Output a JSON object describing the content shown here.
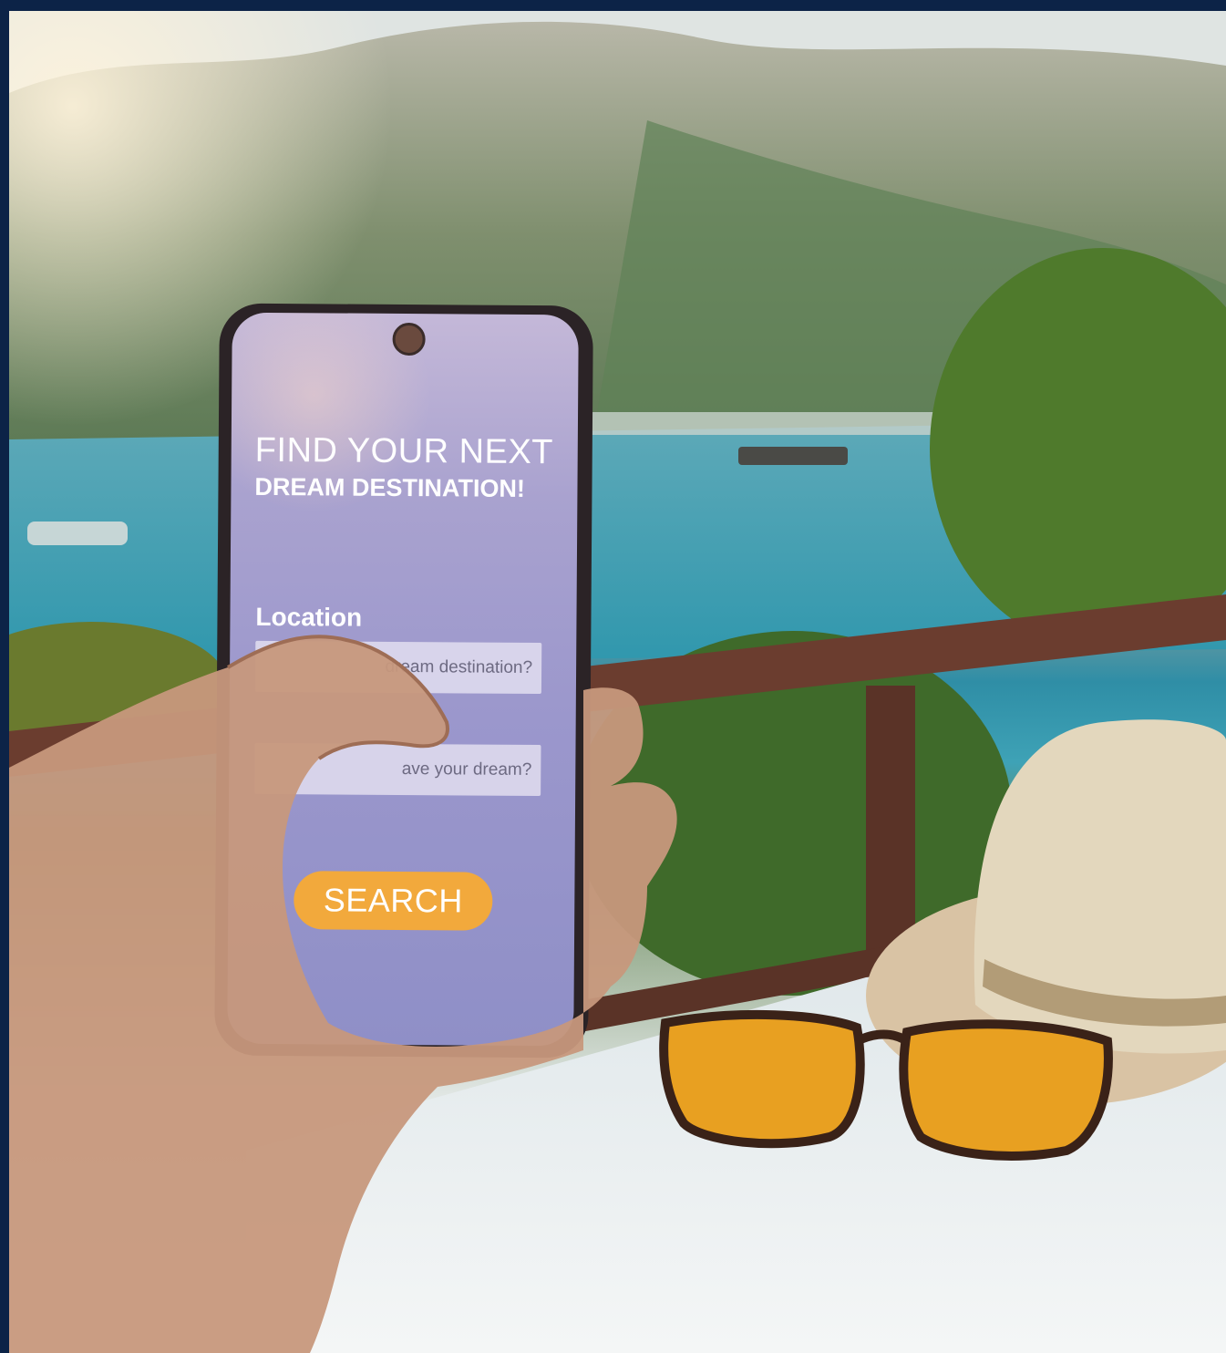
{
  "app": {
    "headline_line1": "FIND YOUR NEXT",
    "headline_line2": "DREAM DESTINATION!",
    "location_label": "Location",
    "location_placeholder": "dream destination?",
    "second_placeholder": "ave your dream?",
    "search_label": "SEARCH"
  },
  "colors": {
    "frame": "#0c2347",
    "screen": "#9b97cc",
    "button": "#f2a93c",
    "sea": "#2f97ad"
  },
  "icons": [
    "camera-notch-icon"
  ]
}
